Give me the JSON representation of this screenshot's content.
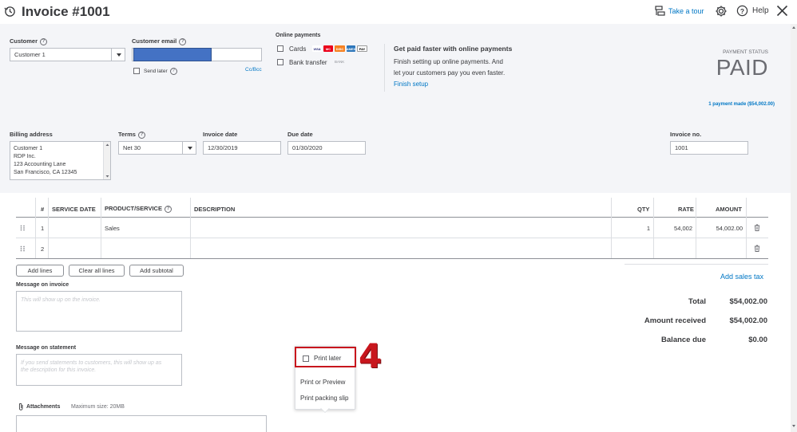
{
  "header": {
    "title": "Invoice #1001",
    "take_tour": "Take a tour",
    "help": "Help"
  },
  "customer": {
    "label": "Customer",
    "value": "Customer 1",
    "email_label": "Customer email",
    "email_value": "",
    "send_later": "Send later",
    "cc_bcc": "Cc/Bcc"
  },
  "online_payments": {
    "label": "Online payments",
    "cards": "Cards",
    "bank_transfer": "Bank transfer",
    "bank_badge": "BANK",
    "card_brands": [
      "VISA",
      "MC",
      "DISC",
      "AMEX",
      "PAY"
    ],
    "promo_title": "Get paid faster with online payments",
    "promo_line1": "Finish setting up online payments. And",
    "promo_line2": "let your customers pay you even faster.",
    "finish_setup": "Finish setup"
  },
  "payment_status": {
    "label": "PAYMENT STATUS",
    "value": "PAID",
    "payments_made": "1 payment made ($54,002.00)"
  },
  "billing": {
    "label": "Billing address",
    "lines": [
      "Customer 1",
      "RDP Inc.",
      "123 Accounting Lane",
      "San Francisco, CA  12345"
    ]
  },
  "terms": {
    "label": "Terms",
    "value": "Net 30"
  },
  "invoice_date": {
    "label": "Invoice date",
    "value": "12/30/2019"
  },
  "due_date": {
    "label": "Due date",
    "value": "01/30/2020"
  },
  "invoice_no": {
    "label": "Invoice no.",
    "value": "1001"
  },
  "table": {
    "headers": {
      "num": "#",
      "service_date": "SERVICE DATE",
      "product": "PRODUCT/SERVICE",
      "description": "DESCRIPTION",
      "qty": "QTY",
      "rate": "RATE",
      "amount": "AMOUNT"
    },
    "rows": [
      {
        "num": "1",
        "product": "Sales",
        "qty": "1",
        "rate": "54,002",
        "amount": "54,002.00"
      },
      {
        "num": "2",
        "product": "",
        "qty": "",
        "rate": "",
        "amount": ""
      }
    ]
  },
  "actions": {
    "add_lines": "Add lines",
    "clear_all_lines": "Clear all lines",
    "add_subtotal": "Add subtotal",
    "add_sales_tax": "Add sales tax"
  },
  "message_invoice": {
    "label": "Message on invoice",
    "placeholder": "This will show up on the invoice."
  },
  "message_statement": {
    "label": "Message on statement",
    "placeholder_line1": "If you send statements to customers, this will show up as",
    "placeholder_line2": "the description for this invoice."
  },
  "attachments": {
    "label": "Attachments",
    "max_size": "Maximum size: 20MB"
  },
  "totals": {
    "total_label": "Total",
    "total_value": "$54,002.00",
    "received_label": "Amount received",
    "received_value": "$54,002.00",
    "balance_label": "Balance due",
    "balance_value": "$0.00"
  },
  "print_menu": {
    "print_later": "Print later",
    "print_preview": "Print or Preview",
    "print_slip": "Print packing slip"
  },
  "callout": {
    "number": "4"
  },
  "colors": {
    "accent": "#0077c5",
    "callout": "#c8161d",
    "panel": "#f4f5f8"
  }
}
